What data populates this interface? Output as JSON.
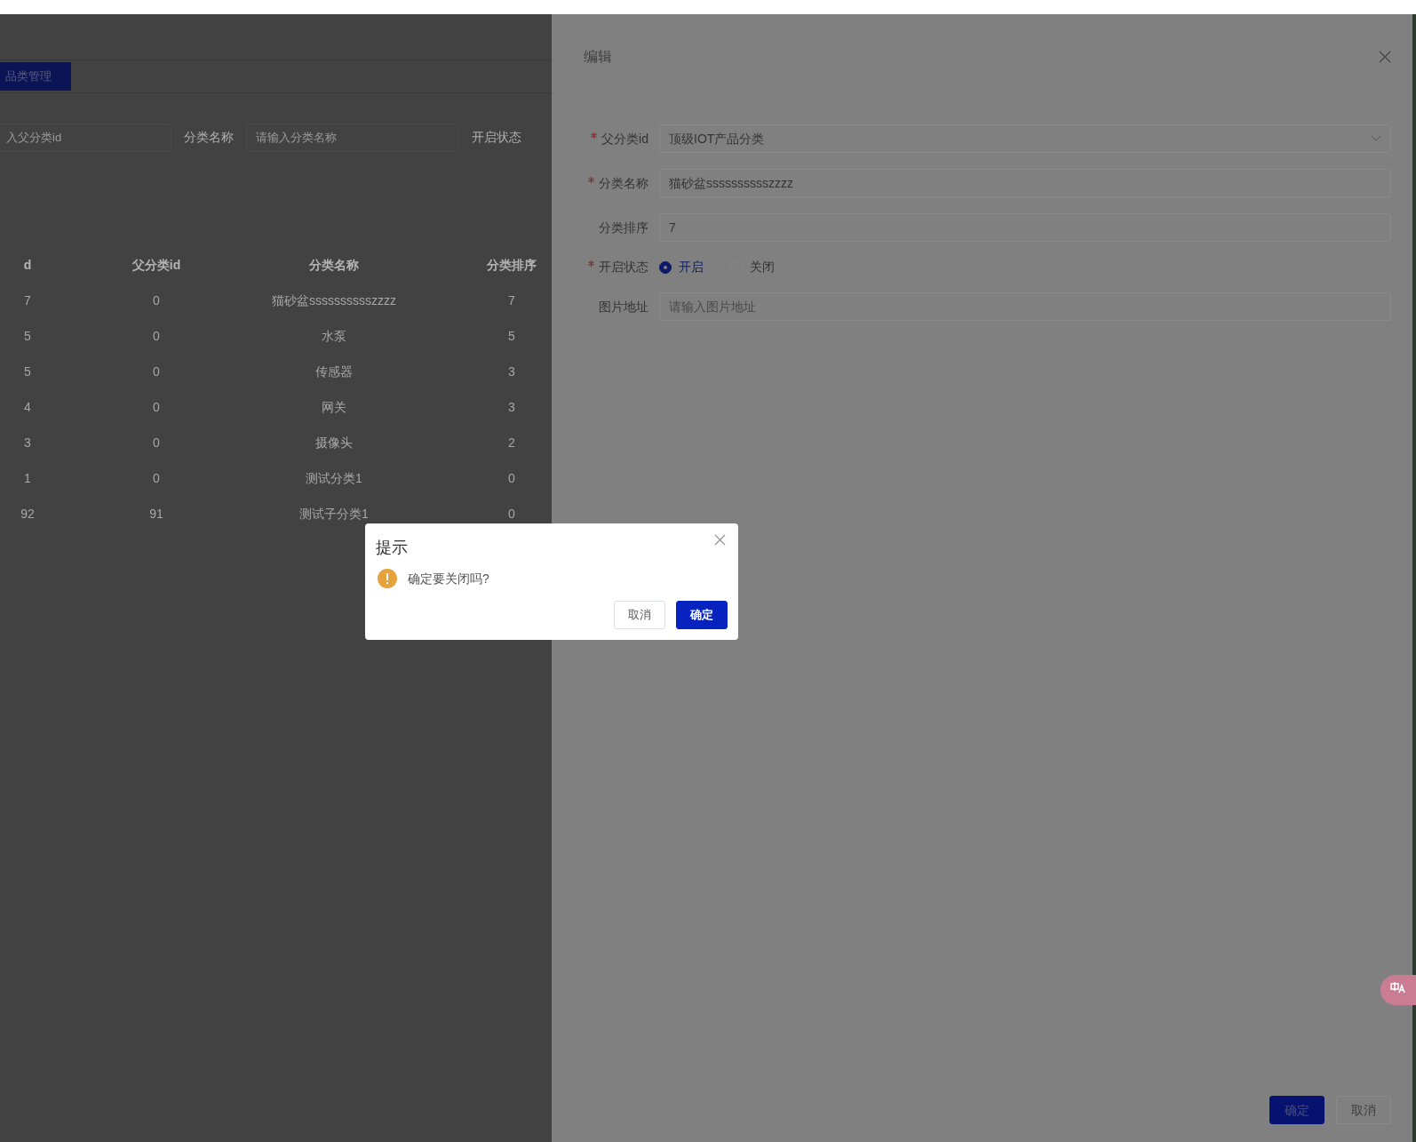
{
  "page": {
    "tabs": [
      {
        "label": "品类管理",
        "selected": true
      }
    ],
    "filters": [
      {
        "kind": "input",
        "placeholder": "入父分类id"
      },
      {
        "kind": "input",
        "label": "分类名称",
        "placeholder": "请输入分类名称"
      },
      {
        "kind": "label",
        "label": "开启状态"
      }
    ],
    "table": {
      "columns": [
        "d",
        "父分类id",
        "分类名称",
        "分类排序"
      ],
      "rows": [
        [
          "7",
          "0",
          "猫砂盆sssssssssszzzz",
          "7"
        ],
        [
          "5",
          "0",
          "水泵",
          "5"
        ],
        [
          "5",
          "0",
          "传感器",
          "3"
        ],
        [
          "4",
          "0",
          "网关",
          "3"
        ],
        [
          "3",
          "0",
          "摄像头",
          "2"
        ],
        [
          "1",
          "0",
          "测试分类1",
          "0"
        ],
        [
          "92",
          "91",
          "测试子分类1",
          "0"
        ]
      ]
    }
  },
  "drawer": {
    "title": "编辑",
    "fields": [
      {
        "kind": "select",
        "label": "父分类id",
        "required": true,
        "value": "顶级IOT产品分类"
      },
      {
        "kind": "input",
        "label": "分类名称",
        "required": true,
        "value": "猫砂盆sssssssssszzzz"
      },
      {
        "kind": "input",
        "label": "分类排序",
        "required": false,
        "value": "7"
      },
      {
        "kind": "radio",
        "label": "开启状态",
        "required": true,
        "options": [
          {
            "label": "开启",
            "selected": true
          },
          {
            "label": "关闭",
            "selected": false
          }
        ]
      },
      {
        "kind": "input",
        "label": "图片地址",
        "required": false,
        "placeholder": "请输入图片地址"
      }
    ],
    "buttons": [
      {
        "kind": "primary",
        "label": "确定"
      },
      {
        "kind": "default",
        "label": "取消"
      }
    ]
  },
  "dialog": {
    "title": "提示",
    "message": "确定要关闭吗?",
    "buttons": [
      {
        "kind": "default",
        "label": "取消"
      },
      {
        "kind": "primary",
        "label": "确定"
      }
    ]
  }
}
